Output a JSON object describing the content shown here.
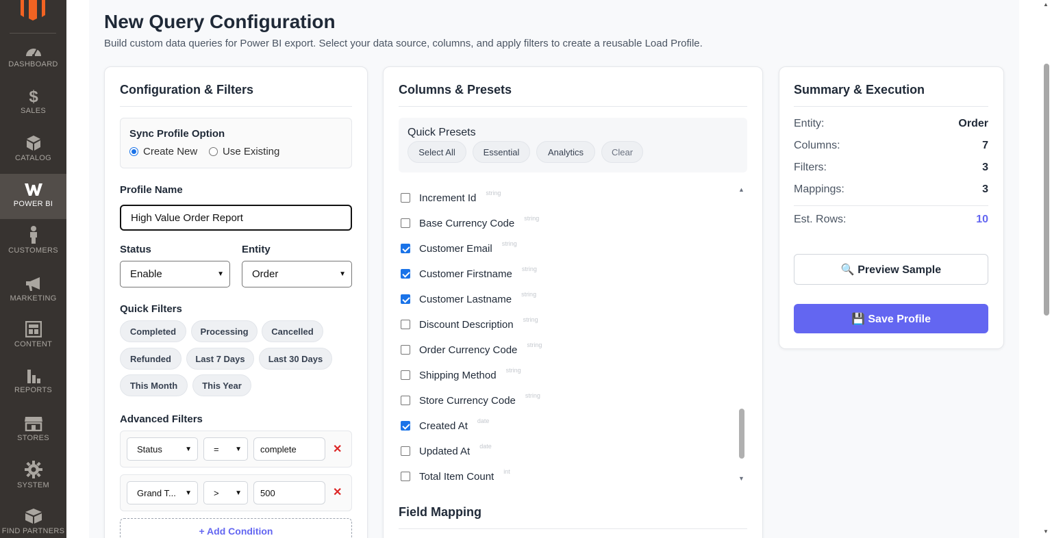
{
  "sidebar": {
    "items": [
      {
        "label": "DASHBOARD",
        "icon": "dashboard-icon"
      },
      {
        "label": "SALES",
        "icon": "dollar-icon"
      },
      {
        "label": "CATALOG",
        "icon": "cube-icon"
      },
      {
        "label": "POWER BI",
        "icon": "power-bi-icon"
      },
      {
        "label": "CUSTOMERS",
        "icon": "person-icon"
      },
      {
        "label": "MARKETING",
        "icon": "megaphone-icon"
      },
      {
        "label": "CONTENT",
        "icon": "layout-icon"
      },
      {
        "label": "REPORTS",
        "icon": "bar-chart-icon"
      },
      {
        "label": "STORES",
        "icon": "storefront-icon"
      },
      {
        "label": "SYSTEM",
        "icon": "gear-icon"
      },
      {
        "label": "FIND PARTNERS",
        "icon": "box-icon"
      }
    ],
    "active": "POWER BI"
  },
  "header": {
    "title": "New Query Configuration",
    "subtitle": "Build custom data queries for Power BI export. Select your data source, columns, and apply filters to create a reusable Load Profile."
  },
  "config": {
    "title": "Configuration & Filters",
    "sync_label": "Sync Profile Option",
    "sync_options": [
      "Create New",
      "Use Existing"
    ],
    "sync_selected": "Create New",
    "profile_name_label": "Profile Name",
    "profile_name_value": "High Value Order Report",
    "status_label": "Status",
    "status_value": "Enable",
    "entity_label": "Entity",
    "entity_value": "Order",
    "quick_filters_label": "Quick Filters",
    "quick_filters": [
      "Completed",
      "Processing",
      "Cancelled",
      "Refunded",
      "Last 7 Days",
      "Last 30 Days",
      "This Month",
      "This Year"
    ],
    "advanced_filters_label": "Advanced Filters",
    "advanced_filters": [
      {
        "field": "Status",
        "op": "=",
        "value": "complete"
      },
      {
        "field": "Grand T...",
        "op": ">",
        "value": "500"
      }
    ],
    "remove_glyph": "✕",
    "add_condition": "+ Add Condition"
  },
  "columns": {
    "title": "Columns & Presets",
    "presets_label": "Quick Presets",
    "presets": [
      "Select All",
      "Essential",
      "Analytics",
      "Clear"
    ],
    "items": [
      {
        "name": "Increment Id",
        "type": "string",
        "checked": false
      },
      {
        "name": "Base Currency Code",
        "type": "string",
        "checked": false
      },
      {
        "name": "Customer Email",
        "type": "string",
        "checked": true
      },
      {
        "name": "Customer Firstname",
        "type": "string",
        "checked": true
      },
      {
        "name": "Customer Lastname",
        "type": "string",
        "checked": true
      },
      {
        "name": "Discount Description",
        "type": "string",
        "checked": false
      },
      {
        "name": "Order Currency Code",
        "type": "string",
        "checked": false
      },
      {
        "name": "Shipping Method",
        "type": "string",
        "checked": false
      },
      {
        "name": "Store Currency Code",
        "type": "string",
        "checked": false
      },
      {
        "name": "Created At",
        "type": "date",
        "checked": true
      },
      {
        "name": "Updated At",
        "type": "date",
        "checked": false
      },
      {
        "name": "Total Item Count",
        "type": "int",
        "checked": false
      }
    ],
    "field_mapping_title": "Field Mapping"
  },
  "summary": {
    "title": "Summary & Execution",
    "rows": [
      {
        "label": "Entity:",
        "value": "Order"
      },
      {
        "label": "Columns:",
        "value": "7"
      },
      {
        "label": "Filters:",
        "value": "3"
      },
      {
        "label": "Mappings:",
        "value": "3"
      }
    ],
    "est_rows_label": "Est. Rows:",
    "est_rows_value": "10",
    "preview_button": "🔍 Preview Sample",
    "save_button": "💾 Save Profile"
  },
  "colors": {
    "sidebar_bg": "#373330",
    "accent": "#6366f1",
    "checkbox": "#1a73e8",
    "danger": "#dc2626"
  }
}
